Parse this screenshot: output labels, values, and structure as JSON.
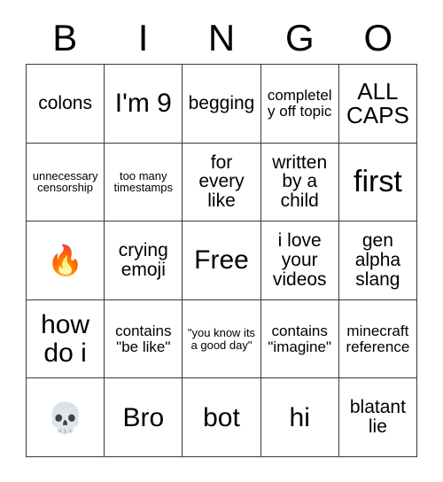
{
  "header": {
    "letters": [
      "B",
      "I",
      "N",
      "G",
      "O"
    ]
  },
  "grid": {
    "rows": [
      [
        {
          "text": "colons",
          "size": "md"
        },
        {
          "text": "I'm 9",
          "size": "xl"
        },
        {
          "text": "begging",
          "size": "md"
        },
        {
          "text": "completely off topic",
          "size": "sm"
        },
        {
          "text": "ALL CAPS",
          "size": "lg"
        }
      ],
      [
        {
          "text": "unnecessary censorship",
          "size": "xs"
        },
        {
          "text": "too many timestamps",
          "size": "xs"
        },
        {
          "text": "for every like",
          "size": "md"
        },
        {
          "text": "written by a child",
          "size": "md"
        },
        {
          "text": "first",
          "size": "xxl"
        }
      ],
      [
        {
          "text": "🔥",
          "size": "emoji"
        },
        {
          "text": "crying emoji",
          "size": "md"
        },
        {
          "text": "Free",
          "size": "xl"
        },
        {
          "text": "i love your videos",
          "size": "md"
        },
        {
          "text": "gen alpha slang",
          "size": "md"
        }
      ],
      [
        {
          "text": "how do i",
          "size": "xl"
        },
        {
          "text": "contains \"be like\"",
          "size": "sm"
        },
        {
          "text": "\"you know its a good day\"",
          "size": "xs"
        },
        {
          "text": "contains \"imagine\"",
          "size": "sm"
        },
        {
          "text": "minecraft reference",
          "size": "sm"
        }
      ],
      [
        {
          "text": "💀",
          "size": "emoji"
        },
        {
          "text": "Bro",
          "size": "xl"
        },
        {
          "text": "bot",
          "size": "xl"
        },
        {
          "text": "hi",
          "size": "xl"
        },
        {
          "text": "blatant lie",
          "size": "md"
        }
      ]
    ]
  },
  "colors": {
    "border": "#3a3a3a",
    "background": "#ffffff",
    "text": "#000000"
  }
}
